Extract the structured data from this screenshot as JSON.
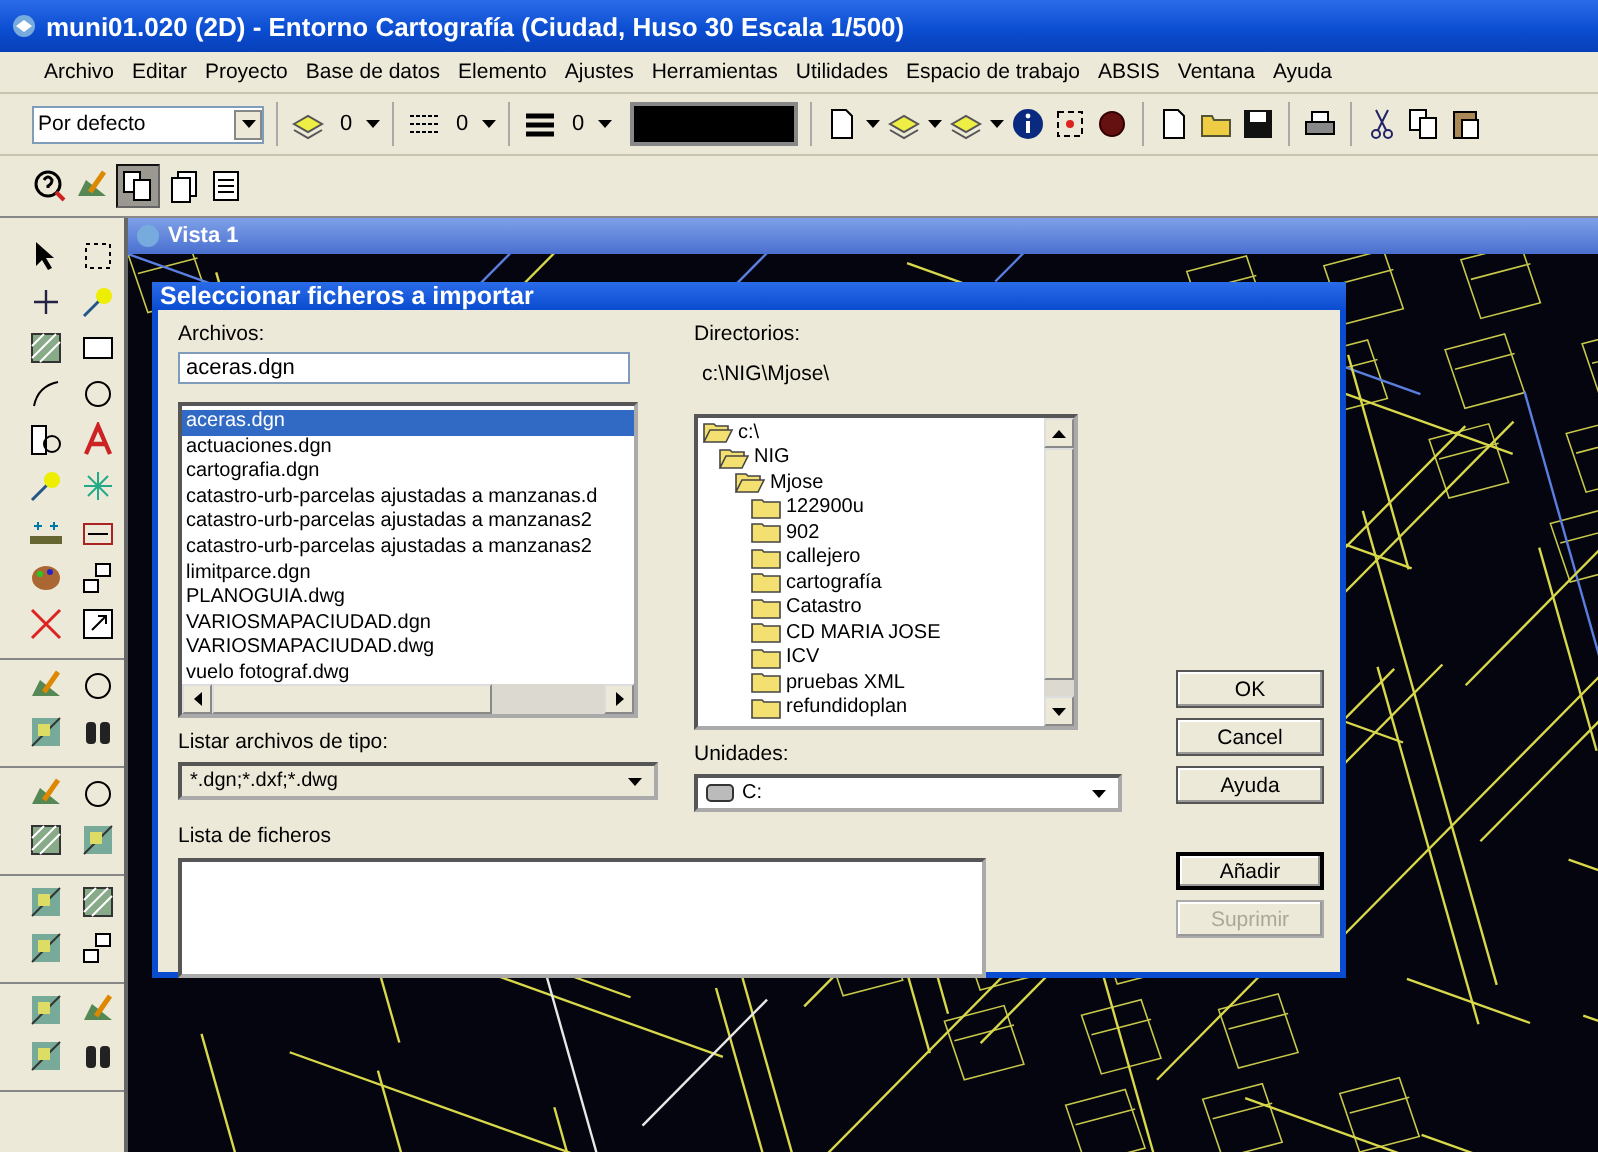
{
  "window": {
    "title": "muni01.020 (2D) - Entorno Cartografía (Ciudad, Huso 30 Escala 1/500)"
  },
  "menu": [
    "Archivo",
    "Editar",
    "Proyecto",
    "Base de datos",
    "Elemento",
    "Ajustes",
    "Herramientas",
    "Utilidades",
    "Espacio de trabajo",
    "ABSIS",
    "Ventana",
    "Ayuda"
  ],
  "toolbar": {
    "style_combo": "Por defecto",
    "level_values": [
      "0",
      "0",
      "0"
    ]
  },
  "view_window": {
    "title": "Vista 1"
  },
  "dialog": {
    "title": "Seleccionar ficheros a importar",
    "files_label": "Archivos:",
    "file_name": "aceras.dgn",
    "files": [
      {
        "name": "aceras.dgn",
        "selected": true
      },
      {
        "name": "actuaciones.dgn",
        "selected": false
      },
      {
        "name": "cartografia.dgn",
        "selected": false
      },
      {
        "name": "catastro-urb-parcelas ajustadas a manzanas.d",
        "selected": false
      },
      {
        "name": "catastro-urb-parcelas ajustadas a manzanas2",
        "selected": false
      },
      {
        "name": "catastro-urb-parcelas ajustadas a manzanas2",
        "selected": false
      },
      {
        "name": "limitparce.dgn",
        "selected": false
      },
      {
        "name": "PLANOGUIA.dwg",
        "selected": false
      },
      {
        "name": "VARIOSMAPACIUDAD.dgn",
        "selected": false
      },
      {
        "name": "VARIOSMAPACIUDAD.dwg",
        "selected": false
      },
      {
        "name": "vuelo fotograf.dwg",
        "selected": false
      }
    ],
    "file_type_label": "Listar archivos de tipo:",
    "file_type": "*.dgn;*.dxf;*.dwg",
    "directories_label": "Directorios:",
    "current_path": "c:\\NIG\\Mjose\\",
    "directories": [
      {
        "name": "c:\\",
        "expanded": true,
        "children": [
          {
            "name": "NIG",
            "expanded": true,
            "children": [
              {
                "name": "Mjose",
                "expanded": true,
                "children": [
                  {
                    "name": "122900u",
                    "expanded": false
                  },
                  {
                    "name": "902",
                    "expanded": false
                  },
                  {
                    "name": "callejero",
                    "expanded": false
                  },
                  {
                    "name": "cartografía",
                    "expanded": false
                  },
                  {
                    "name": "Catastro",
                    "expanded": false
                  },
                  {
                    "name": "CD MARIA JOSE",
                    "expanded": false
                  },
                  {
                    "name": "ICV",
                    "expanded": false
                  },
                  {
                    "name": "pruebas XML",
                    "expanded": false
                  },
                  {
                    "name": "refundidoplan",
                    "expanded": false
                  }
                ]
              }
            ]
          }
        ]
      }
    ],
    "drives_label": "Unidades:",
    "drive": "C:",
    "file_list_label": "Lista de ficheros",
    "buttons": [
      {
        "label": "OK",
        "disabled": false
      },
      {
        "label": "Cancel",
        "disabled": false
      },
      {
        "label": "Ayuda",
        "disabled": false
      }
    ],
    "list_buttons": [
      {
        "label": "Añadir",
        "disabled": false
      },
      {
        "label": "Suprimir",
        "disabled": true
      }
    ]
  }
}
